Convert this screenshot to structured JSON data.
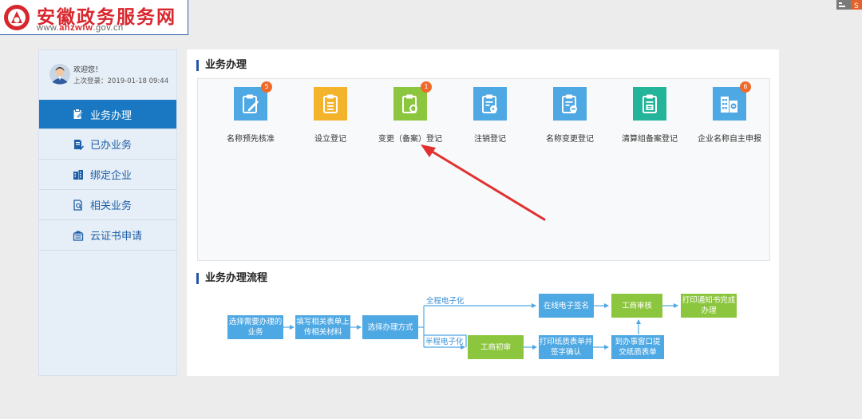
{
  "header": {
    "site_title": "安徽政务服务网",
    "url_prefix": "www.",
    "url_brand": "ahzwfw",
    "url_suffix": ".gov.cn",
    "brand_color": "#d8262d"
  },
  "sidebar": {
    "welcome": "欢迎您！",
    "last_login": "上次登录：2019-01-18 09:44",
    "items": [
      {
        "label": "业务办理",
        "icon": "clipboard-edit-icon",
        "active": true
      },
      {
        "label": "已办业务",
        "icon": "document-check-icon",
        "active": false
      },
      {
        "label": "绑定企业",
        "icon": "building-icon",
        "active": false
      },
      {
        "label": "相关业务",
        "icon": "document-search-icon",
        "active": false
      },
      {
        "label": "云证书申请",
        "icon": "certificate-icon",
        "active": false
      }
    ],
    "accent_color": "#1a78c2"
  },
  "main": {
    "business_title": "业务办理",
    "services": [
      {
        "label": "名称预先核准",
        "icon": "clipboard-pen-icon",
        "color": "#4ea8e3",
        "badge": "5"
      },
      {
        "label": "设立登记",
        "icon": "clipboard-list-icon",
        "color": "#f3b32a",
        "badge": ""
      },
      {
        "label": "变更（备案）登记",
        "icon": "clipboard-refresh-icon",
        "color": "#8cc63e",
        "badge": "1"
      },
      {
        "label": "注销登记",
        "icon": "clipboard-cancel-icon",
        "color": "#4ea8e3",
        "badge": ""
      },
      {
        "label": "名称变更登记",
        "icon": "clipboard-minus-icon",
        "color": "#4ea8e3",
        "badge": ""
      },
      {
        "label": "清算组备案登记",
        "icon": "clipboard-stamp-icon",
        "color": "#23b49a",
        "badge": ""
      },
      {
        "label": "企业名称自主申报",
        "icon": "building-report-icon",
        "color": "#4ea8e3",
        "badge": "6"
      }
    ],
    "flow_title": "业务办理流程",
    "flow": {
      "step1": "选择需要办理的业务",
      "step2": "填写相关表单上传相关材料",
      "step3": "选择办理方式",
      "path_full": "全程电子化",
      "path_half": "半程电子化",
      "online_sign": "在线电子签名",
      "review": "工商审核",
      "print_notice": "打印通知书完成办理",
      "initial_review": "工商初审",
      "print_forms": "打印纸质表单并签字确认",
      "submit_window": "到办事窗口提交纸质表单"
    }
  }
}
